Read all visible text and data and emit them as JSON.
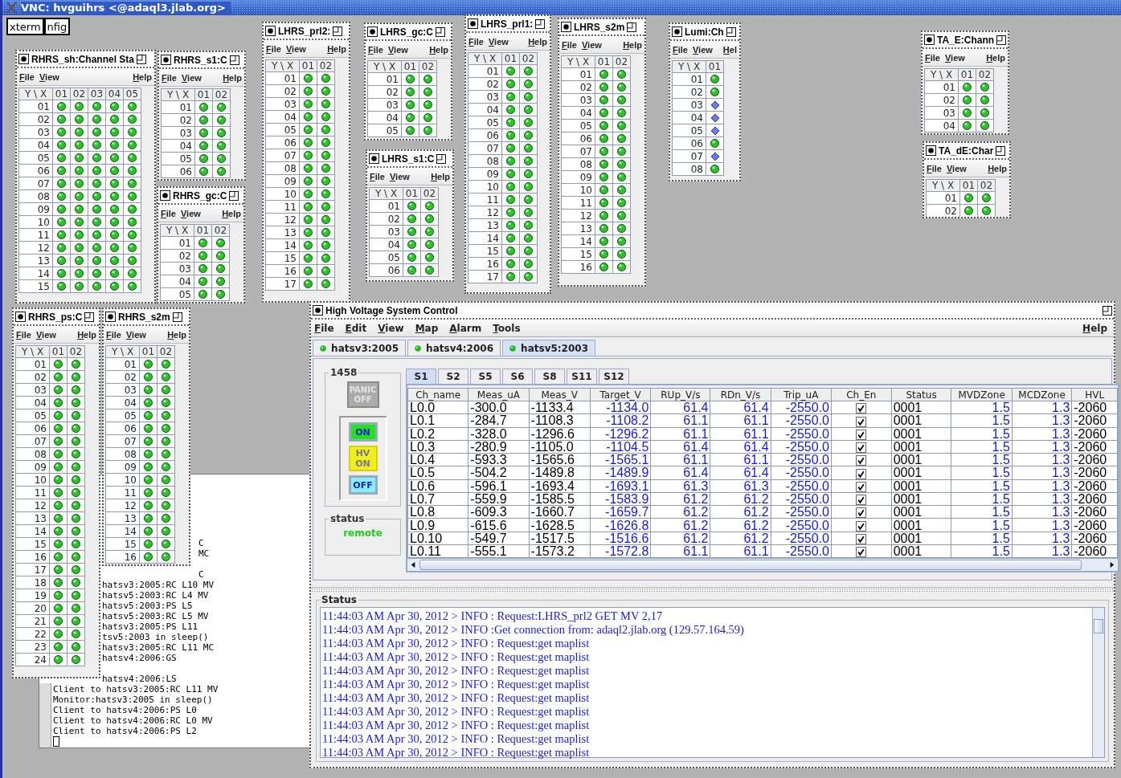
{
  "vnc": {
    "title": "VNC: hvguihrs <@adaql3.jlab.org>",
    "launchers": [
      "xterm",
      "nfig"
    ]
  },
  "windows": [
    {
      "title": "RHRS_sh:Channel Sta",
      "menu": [
        "File",
        "View",
        "Help"
      ],
      "columns": [
        "Y \\ X",
        "01",
        "02",
        "03",
        "04",
        "05"
      ],
      "rows": [
        {
          "label": "01",
          "cells": [
            {
              "kind": "led"
            },
            {
              "kind": "led"
            },
            {
              "kind": "led"
            },
            {
              "kind": "led"
            },
            {
              "kind": "led"
            }
          ]
        },
        {
          "label": "02",
          "cells": [
            {
              "kind": "led"
            },
            {
              "kind": "led"
            },
            {
              "kind": "led"
            },
            {
              "kind": "led"
            },
            {
              "kind": "led"
            }
          ]
        },
        {
          "label": "03",
          "cells": [
            {
              "kind": "led"
            },
            {
              "kind": "led"
            },
            {
              "kind": "led"
            },
            {
              "kind": "led"
            },
            {
              "kind": "led"
            }
          ]
        },
        {
          "label": "04",
          "cells": [
            {
              "kind": "led"
            },
            {
              "kind": "led"
            },
            {
              "kind": "led"
            },
            {
              "kind": "led"
            },
            {
              "kind": "led"
            }
          ]
        },
        {
          "label": "05",
          "cells": [
            {
              "kind": "led"
            },
            {
              "kind": "led"
            },
            {
              "kind": "led"
            },
            {
              "kind": "led"
            },
            {
              "kind": "led"
            }
          ]
        },
        {
          "label": "06",
          "cells": [
            {
              "kind": "led"
            },
            {
              "kind": "led"
            },
            {
              "kind": "led"
            },
            {
              "kind": "led"
            },
            {
              "kind": "led"
            }
          ]
        },
        {
          "label": "07",
          "cells": [
            {
              "kind": "led"
            },
            {
              "kind": "led"
            },
            {
              "kind": "led"
            },
            {
              "kind": "led"
            },
            {
              "kind": "led"
            }
          ]
        },
        {
          "label": "08",
          "cells": [
            {
              "kind": "led"
            },
            {
              "kind": "led"
            },
            {
              "kind": "led"
            },
            {
              "kind": "led"
            },
            {
              "kind": "led"
            }
          ]
        },
        {
          "label": "09",
          "cells": [
            {
              "kind": "led"
            },
            {
              "kind": "led"
            },
            {
              "kind": "led"
            },
            {
              "kind": "led"
            },
            {
              "kind": "led"
            }
          ]
        },
        {
          "label": "10",
          "cells": [
            {
              "kind": "led"
            },
            {
              "kind": "led"
            },
            {
              "kind": "led"
            },
            {
              "kind": "led"
            },
            {
              "kind": "led"
            }
          ]
        },
        {
          "label": "11",
          "cells": [
            {
              "kind": "led"
            },
            {
              "kind": "led"
            },
            {
              "kind": "led"
            },
            {
              "kind": "led"
            },
            {
              "kind": "led"
            }
          ]
        },
        {
          "label": "12",
          "cells": [
            {
              "kind": "led"
            },
            {
              "kind": "led"
            },
            {
              "kind": "led"
            },
            {
              "kind": "led"
            },
            {
              "kind": "led"
            }
          ]
        },
        {
          "label": "13",
          "cells": [
            {
              "kind": "led"
            },
            {
              "kind": "led"
            },
            {
              "kind": "led"
            },
            {
              "kind": "led"
            },
            {
              "kind": "led"
            }
          ]
        },
        {
          "label": "14",
          "cells": [
            {
              "kind": "led"
            },
            {
              "kind": "led"
            },
            {
              "kind": "led"
            },
            {
              "kind": "led"
            },
            {
              "kind": "led"
            }
          ]
        },
        {
          "label": "15",
          "cells": [
            {
              "kind": "led"
            },
            {
              "kind": "led"
            },
            {
              "kind": "led"
            },
            {
              "kind": "led"
            },
            {
              "kind": "led"
            }
          ]
        }
      ]
    },
    {
      "title": "RHRS_s1:C",
      "menu": [
        "File",
        "View",
        "Help"
      ],
      "columns": [
        "Y \\ X",
        "01",
        "02"
      ],
      "rows": [
        {
          "label": "01",
          "cells": [
            {
              "kind": "led"
            },
            {
              "kind": "led"
            }
          ]
        },
        {
          "label": "02",
          "cells": [
            {
              "kind": "led"
            },
            {
              "kind": "led"
            }
          ]
        },
        {
          "label": "03",
          "cells": [
            {
              "kind": "led"
            },
            {
              "kind": "led"
            }
          ]
        },
        {
          "label": "04",
          "cells": [
            {
              "kind": "led"
            },
            {
              "kind": "led"
            }
          ]
        },
        {
          "label": "05",
          "cells": [
            {
              "kind": "led"
            },
            {
              "kind": "led"
            }
          ]
        },
        {
          "label": "06",
          "cells": [
            {
              "kind": "led"
            },
            {
              "kind": "led"
            }
          ]
        }
      ]
    },
    {
      "title": "RHRS_gc:C",
      "menu": [
        "File",
        "View",
        "Help"
      ],
      "columns": [
        "Y \\ X",
        "01",
        "02"
      ],
      "rows": [
        {
          "label": "01",
          "cells": [
            {
              "kind": "led"
            },
            {
              "kind": "led"
            }
          ]
        },
        {
          "label": "02",
          "cells": [
            {
              "kind": "led"
            },
            {
              "kind": "led"
            }
          ]
        },
        {
          "label": "03",
          "cells": [
            {
              "kind": "led"
            },
            {
              "kind": "led"
            }
          ]
        },
        {
          "label": "04",
          "cells": [
            {
              "kind": "led"
            },
            {
              "kind": "led"
            }
          ]
        },
        {
          "label": "05",
          "cells": [
            {
              "kind": "led"
            },
            {
              "kind": "led"
            }
          ]
        }
      ]
    },
    {
      "title": "LHRS_prl2:",
      "menu": [
        "File",
        "View",
        "Help"
      ],
      "columns": [
        "Y \\ X",
        "01",
        "02"
      ],
      "rows": [
        {
          "label": "01",
          "cells": [
            {
              "kind": "led"
            },
            {
              "kind": "led"
            }
          ]
        },
        {
          "label": "02",
          "cells": [
            {
              "kind": "led"
            },
            {
              "kind": "led"
            }
          ]
        },
        {
          "label": "03",
          "cells": [
            {
              "kind": "led"
            },
            {
              "kind": "led"
            }
          ]
        },
        {
          "label": "04",
          "cells": [
            {
              "kind": "led"
            },
            {
              "kind": "led"
            }
          ]
        },
        {
          "label": "05",
          "cells": [
            {
              "kind": "led"
            },
            {
              "kind": "led"
            }
          ]
        },
        {
          "label": "06",
          "cells": [
            {
              "kind": "led"
            },
            {
              "kind": "led"
            }
          ]
        },
        {
          "label": "07",
          "cells": [
            {
              "kind": "led"
            },
            {
              "kind": "led"
            }
          ]
        },
        {
          "label": "08",
          "cells": [
            {
              "kind": "led"
            },
            {
              "kind": "led"
            }
          ]
        },
        {
          "label": "09",
          "cells": [
            {
              "kind": "led"
            },
            {
              "kind": "led"
            }
          ]
        },
        {
          "label": "10",
          "cells": [
            {
              "kind": "led"
            },
            {
              "kind": "led"
            }
          ]
        },
        {
          "label": "11",
          "cells": [
            {
              "kind": "led"
            },
            {
              "kind": "led"
            }
          ]
        },
        {
          "label": "12",
          "cells": [
            {
              "kind": "led"
            },
            {
              "kind": "led"
            }
          ]
        },
        {
          "label": "13",
          "cells": [
            {
              "kind": "led"
            },
            {
              "kind": "led"
            }
          ]
        },
        {
          "label": "14",
          "cells": [
            {
              "kind": "led"
            },
            {
              "kind": "led"
            }
          ]
        },
        {
          "label": "15",
          "cells": [
            {
              "kind": "led"
            },
            {
              "kind": "led"
            }
          ]
        },
        {
          "label": "16",
          "cells": [
            {
              "kind": "led"
            },
            {
              "kind": "led"
            }
          ]
        },
        {
          "label": "17",
          "cells": [
            {
              "kind": "led"
            },
            {
              "kind": "led"
            }
          ]
        }
      ]
    },
    {
      "title": "LHRS_gc:C",
      "menu": [
        "File",
        "View",
        "Help"
      ],
      "columns": [
        "Y \\ X",
        "01",
        "02"
      ],
      "rows": [
        {
          "label": "01",
          "cells": [
            {
              "kind": "led"
            },
            {
              "kind": "led"
            }
          ]
        },
        {
          "label": "02",
          "cells": [
            {
              "kind": "led"
            },
            {
              "kind": "led"
            }
          ]
        },
        {
          "label": "03",
          "cells": [
            {
              "kind": "led"
            },
            {
              "kind": "led"
            }
          ]
        },
        {
          "label": "04",
          "cells": [
            {
              "kind": "led"
            },
            {
              "kind": "led"
            }
          ]
        },
        {
          "label": "05",
          "cells": [
            {
              "kind": "led"
            },
            {
              "kind": "led"
            }
          ]
        }
      ]
    },
    {
      "title": "LHRS_s1:C",
      "menu": [
        "File",
        "View",
        "Help"
      ],
      "columns": [
        "Y \\ X",
        "01",
        "02"
      ],
      "rows": [
        {
          "label": "01",
          "cells": [
            {
              "kind": "led"
            },
            {
              "kind": "led"
            }
          ]
        },
        {
          "label": "02",
          "cells": [
            {
              "kind": "led"
            },
            {
              "kind": "led"
            }
          ]
        },
        {
          "label": "03",
          "cells": [
            {
              "kind": "led"
            },
            {
              "kind": "led"
            }
          ]
        },
        {
          "label": "04",
          "cells": [
            {
              "kind": "led"
            },
            {
              "kind": "led"
            }
          ]
        },
        {
          "label": "05",
          "cells": [
            {
              "kind": "led"
            },
            {
              "kind": "led"
            }
          ]
        },
        {
          "label": "06",
          "cells": [
            {
              "kind": "led"
            },
            {
              "kind": "led"
            }
          ]
        }
      ]
    },
    {
      "title": "LHRS_prl1:",
      "menu": [
        "File",
        "View",
        "Help"
      ],
      "columns": [
        "Y \\ X",
        "01",
        "02"
      ],
      "rows": [
        {
          "label": "01",
          "cells": [
            {
              "kind": "led"
            },
            {
              "kind": "led"
            }
          ]
        },
        {
          "label": "02",
          "cells": [
            {
              "kind": "led"
            },
            {
              "kind": "led"
            }
          ]
        },
        {
          "label": "03",
          "cells": [
            {
              "kind": "led"
            },
            {
              "kind": "led"
            }
          ]
        },
        {
          "label": "04",
          "cells": [
            {
              "kind": "led"
            },
            {
              "kind": "led"
            }
          ]
        },
        {
          "label": "05",
          "cells": [
            {
              "kind": "led"
            },
            {
              "kind": "led"
            }
          ]
        },
        {
          "label": "06",
          "cells": [
            {
              "kind": "led"
            },
            {
              "kind": "led"
            }
          ]
        },
        {
          "label": "07",
          "cells": [
            {
              "kind": "led"
            },
            {
              "kind": "led"
            }
          ]
        },
        {
          "label": "08",
          "cells": [
            {
              "kind": "led"
            },
            {
              "kind": "led"
            }
          ]
        },
        {
          "label": "09",
          "cells": [
            {
              "kind": "led"
            },
            {
              "kind": "led"
            }
          ]
        },
        {
          "label": "10",
          "cells": [
            {
              "kind": "led"
            },
            {
              "kind": "led"
            }
          ]
        },
        {
          "label": "11",
          "cells": [
            {
              "kind": "led"
            },
            {
              "kind": "led"
            }
          ]
        },
        {
          "label": "12",
          "cells": [
            {
              "kind": "led"
            },
            {
              "kind": "led"
            }
          ]
        },
        {
          "label": "13",
          "cells": [
            {
              "kind": "led"
            },
            {
              "kind": "led"
            }
          ]
        },
        {
          "label": "14",
          "cells": [
            {
              "kind": "led"
            },
            {
              "kind": "led"
            }
          ]
        },
        {
          "label": "15",
          "cells": [
            {
              "kind": "led"
            },
            {
              "kind": "led"
            }
          ]
        },
        {
          "label": "16",
          "cells": [
            {
              "kind": "led"
            },
            {
              "kind": "led"
            }
          ]
        },
        {
          "label": "17",
          "cells": [
            {
              "kind": "led"
            },
            {
              "kind": "led"
            }
          ]
        }
      ]
    },
    {
      "title": "LHRS_s2m",
      "menu": [
        "File",
        "View",
        "Help"
      ],
      "columns": [
        "Y \\ X",
        "01",
        "02"
      ],
      "rows": [
        {
          "label": "01",
          "cells": [
            {
              "kind": "led"
            },
            {
              "kind": "led"
            }
          ]
        },
        {
          "label": "02",
          "cells": [
            {
              "kind": "led"
            },
            {
              "kind": "led"
            }
          ]
        },
        {
          "label": "03",
          "cells": [
            {
              "kind": "led"
            },
            {
              "kind": "led"
            }
          ]
        },
        {
          "label": "04",
          "cells": [
            {
              "kind": "led"
            },
            {
              "kind": "led"
            }
          ]
        },
        {
          "label": "05",
          "cells": [
            {
              "kind": "led"
            },
            {
              "kind": "led"
            }
          ]
        },
        {
          "label": "06",
          "cells": [
            {
              "kind": "led"
            },
            {
              "kind": "led"
            }
          ]
        },
        {
          "label": "07",
          "cells": [
            {
              "kind": "led"
            },
            {
              "kind": "led"
            }
          ]
        },
        {
          "label": "08",
          "cells": [
            {
              "kind": "led"
            },
            {
              "kind": "led"
            }
          ]
        },
        {
          "label": "09",
          "cells": [
            {
              "kind": "led"
            },
            {
              "kind": "led"
            }
          ]
        },
        {
          "label": "10",
          "cells": [
            {
              "kind": "led"
            },
            {
              "kind": "led"
            }
          ]
        },
        {
          "label": "11",
          "cells": [
            {
              "kind": "led"
            },
            {
              "kind": "led"
            }
          ]
        },
        {
          "label": "12",
          "cells": [
            {
              "kind": "led"
            },
            {
              "kind": "led"
            }
          ]
        },
        {
          "label": "13",
          "cells": [
            {
              "kind": "led"
            },
            {
              "kind": "led"
            }
          ]
        },
        {
          "label": "14",
          "cells": [
            {
              "kind": "led"
            },
            {
              "kind": "led"
            }
          ]
        },
        {
          "label": "15",
          "cells": [
            {
              "kind": "led"
            },
            {
              "kind": "led"
            }
          ]
        },
        {
          "label": "16",
          "cells": [
            {
              "kind": "led"
            },
            {
              "kind": "led"
            }
          ]
        }
      ]
    },
    {
      "title": "Lumi:Ch",
      "menu": [
        "File",
        "View",
        "Hel"
      ],
      "columns": [
        "Y \\ X",
        "01"
      ],
      "rows": [
        {
          "label": "01",
          "cells": [
            {
              "kind": "led"
            }
          ]
        },
        {
          "label": "02",
          "cells": [
            {
              "kind": "led"
            }
          ]
        },
        {
          "label": "03",
          "cells": [
            {
              "kind": "diamond"
            }
          ]
        },
        {
          "label": "04",
          "cells": [
            {
              "kind": "diamond"
            }
          ]
        },
        {
          "label": "05",
          "cells": [
            {
              "kind": "diamond"
            }
          ]
        },
        {
          "label": "06",
          "cells": [
            {
              "kind": "led"
            }
          ]
        },
        {
          "label": "07",
          "cells": [
            {
              "kind": "diamond"
            }
          ]
        },
        {
          "label": "08",
          "cells": [
            {
              "kind": "led"
            }
          ]
        }
      ]
    },
    {
      "title": "TA_E:Chann",
      "menu": [
        "File",
        "View",
        "Help"
      ],
      "columns": [
        "Y \\ X",
        "01",
        "02"
      ],
      "rows": [
        {
          "label": "01",
          "cells": [
            {
              "kind": "led"
            },
            {
              "kind": "led"
            }
          ]
        },
        {
          "label": "02",
          "cells": [
            {
              "kind": "led"
            },
            {
              "kind": "led"
            }
          ]
        },
        {
          "label": "03",
          "cells": [
            {
              "kind": "led"
            },
            {
              "kind": "led"
            }
          ]
        },
        {
          "label": "04",
          "cells": [
            {
              "kind": "led"
            },
            {
              "kind": "led"
            }
          ]
        }
      ]
    },
    {
      "title": "TA_dE:Char",
      "menu": [
        "File",
        "View",
        "Help"
      ],
      "columns": [
        "Y \\ X",
        "01",
        "02"
      ],
      "rows": [
        {
          "label": "01",
          "cells": [
            {
              "kind": "led"
            },
            {
              "kind": "led"
            }
          ]
        },
        {
          "label": "02",
          "cells": [
            {
              "kind": "led"
            },
            {
              "kind": "led"
            }
          ]
        }
      ]
    },
    {
      "title": "RHRS_ps:C",
      "menu": [
        "File",
        "View",
        "Help"
      ],
      "columns": [
        "Y \\ X",
        "01",
        "02"
      ],
      "rows": [
        {
          "label": "01",
          "cells": [
            {
              "kind": "led"
            },
            {
              "kind": "led"
            }
          ]
        },
        {
          "label": "02",
          "cells": [
            {
              "kind": "led"
            },
            {
              "kind": "led"
            }
          ]
        },
        {
          "label": "03",
          "cells": [
            {
              "kind": "led"
            },
            {
              "kind": "led"
            }
          ]
        },
        {
          "label": "04",
          "cells": [
            {
              "kind": "led"
            },
            {
              "kind": "led"
            }
          ]
        },
        {
          "label": "05",
          "cells": [
            {
              "kind": "led"
            },
            {
              "kind": "led"
            }
          ]
        },
        {
          "label": "06",
          "cells": [
            {
              "kind": "led"
            },
            {
              "kind": "led"
            }
          ]
        },
        {
          "label": "07",
          "cells": [
            {
              "kind": "led"
            },
            {
              "kind": "led"
            }
          ]
        },
        {
          "label": "08",
          "cells": [
            {
              "kind": "led"
            },
            {
              "kind": "led"
            }
          ]
        },
        {
          "label": "09",
          "cells": [
            {
              "kind": "led"
            },
            {
              "kind": "led"
            }
          ]
        },
        {
          "label": "10",
          "cells": [
            {
              "kind": "led"
            },
            {
              "kind": "led"
            }
          ]
        },
        {
          "label": "11",
          "cells": [
            {
              "kind": "led"
            },
            {
              "kind": "led"
            }
          ]
        },
        {
          "label": "12",
          "cells": [
            {
              "kind": "led"
            },
            {
              "kind": "led"
            }
          ]
        },
        {
          "label": "13",
          "cells": [
            {
              "kind": "led"
            },
            {
              "kind": "led"
            }
          ]
        },
        {
          "label": "14",
          "cells": [
            {
              "kind": "led"
            },
            {
              "kind": "led"
            }
          ]
        },
        {
          "label": "15",
          "cells": [
            {
              "kind": "led"
            },
            {
              "kind": "led"
            }
          ]
        },
        {
          "label": "16",
          "cells": [
            {
              "kind": "led"
            },
            {
              "kind": "led"
            }
          ]
        },
        {
          "label": "17",
          "cells": [
            {
              "kind": "led"
            },
            {
              "kind": "led"
            }
          ]
        },
        {
          "label": "18",
          "cells": [
            {
              "kind": "led"
            },
            {
              "kind": "led"
            }
          ]
        },
        {
          "label": "19",
          "cells": [
            {
              "kind": "led"
            },
            {
              "kind": "led"
            }
          ]
        },
        {
          "label": "20",
          "cells": [
            {
              "kind": "led"
            },
            {
              "kind": "led"
            }
          ]
        },
        {
          "label": "21",
          "cells": [
            {
              "kind": "led"
            },
            {
              "kind": "led"
            }
          ]
        },
        {
          "label": "22",
          "cells": [
            {
              "kind": "led"
            },
            {
              "kind": "led"
            }
          ]
        },
        {
          "label": "23",
          "cells": [
            {
              "kind": "led"
            },
            {
              "kind": "led"
            }
          ]
        },
        {
          "label": "24",
          "cells": [
            {
              "kind": "led"
            },
            {
              "kind": "led"
            }
          ]
        }
      ]
    },
    {
      "title": "RHRS_s2m",
      "menu": [
        "File",
        "View",
        "Help"
      ],
      "columns": [
        "Y \\ X",
        "01",
        "02"
      ],
      "rows": [
        {
          "label": "01",
          "cells": [
            {
              "kind": "led"
            },
            {
              "kind": "led"
            }
          ]
        },
        {
          "label": "02",
          "cells": [
            {
              "kind": "led"
            },
            {
              "kind": "led"
            }
          ]
        },
        {
          "label": "03",
          "cells": [
            {
              "kind": "led"
            },
            {
              "kind": "led"
            }
          ]
        },
        {
          "label": "04",
          "cells": [
            {
              "kind": "led"
            },
            {
              "kind": "led"
            }
          ]
        },
        {
          "label": "05",
          "cells": [
            {
              "kind": "led"
            },
            {
              "kind": "led"
            }
          ]
        },
        {
          "label": "06",
          "cells": [
            {
              "kind": "led"
            },
            {
              "kind": "led"
            }
          ]
        },
        {
          "label": "07",
          "cells": [
            {
              "kind": "led"
            },
            {
              "kind": "led"
            }
          ]
        },
        {
          "label": "08",
          "cells": [
            {
              "kind": "led"
            },
            {
              "kind": "led"
            }
          ]
        },
        {
          "label": "09",
          "cells": [
            {
              "kind": "led"
            },
            {
              "kind": "led"
            }
          ]
        },
        {
          "label": "10",
          "cells": [
            {
              "kind": "led"
            },
            {
              "kind": "led"
            }
          ]
        },
        {
          "label": "11",
          "cells": [
            {
              "kind": "led"
            },
            {
              "kind": "led"
            }
          ]
        },
        {
          "label": "12",
          "cells": [
            {
              "kind": "led"
            },
            {
              "kind": "led"
            }
          ]
        },
        {
          "label": "13",
          "cells": [
            {
              "kind": "led"
            },
            {
              "kind": "led"
            }
          ]
        },
        {
          "label": "14",
          "cells": [
            {
              "kind": "led"
            },
            {
              "kind": "led"
            }
          ]
        },
        {
          "label": "15",
          "cells": [
            {
              "kind": "led"
            },
            {
              "kind": "led"
            }
          ]
        },
        {
          "label": "16",
          "cells": [
            {
              "kind": "led"
            },
            {
              "kind": "led"
            }
          ]
        }
      ]
    }
  ],
  "xterm": {
    "lines": [
      "C",
      "MC",
      "C",
      "hatsv3:2005:RC L10 MV",
      "hatsv5:2003:RC L4 MV",
      "hatsv5:2003:PS L5",
      "hatsv5:2003:RC L5 MV",
      "hatsv3:2005:PS L11",
      "tsv5:2003 in sleep()",
      "hatsv3:2005:RC L11 MC",
      "hatsv4:2006:GS",
      "hatsv4:2006:LS",
      "Client to hatsv3:2005:RC L11 MV",
      "Monitor:hatsv3:2005 in sleep()",
      "Client to hatsv4:2006:PS L0",
      "Client to hatsv4:2006:RC L0 MV",
      "Client to hatsv4:2006:PS L2"
    ]
  },
  "hv": {
    "title": "High Voltage System Control",
    "menu": [
      "File",
      "Edit",
      "View",
      "Map",
      "Alarm",
      "Tools"
    ],
    "help": "Help",
    "servers": [
      {
        "label": "hatsv3:2005",
        "selected": false
      },
      {
        "label": "hatsv4:2006",
        "selected": false
      },
      {
        "label": "hatsv5:2003",
        "selected": true
      }
    ],
    "crate": "1458",
    "panic": {
      "label": "PANIC OFF",
      "disabled": true
    },
    "controls": [
      {
        "label": "ON",
        "kind": "on"
      },
      {
        "label": "HV ON",
        "kind": "indicator"
      },
      {
        "label": "OFF",
        "kind": "off"
      }
    ],
    "status": {
      "label": "status",
      "value": "remote"
    },
    "slots": [
      {
        "label": "S1",
        "selected": true
      },
      {
        "label": "S2",
        "selected": false
      },
      {
        "label": "S5",
        "selected": false
      },
      {
        "label": "S6",
        "selected": false
      },
      {
        "label": "S8",
        "selected": false
      },
      {
        "label": "S11",
        "selected": false
      },
      {
        "label": "S12",
        "selected": false
      }
    ],
    "columns": [
      {
        "label": "Ch_name",
        "kind": "text"
      },
      {
        "label": "Meas_uA",
        "kind": "text"
      },
      {
        "label": "Meas_V",
        "kind": "text"
      },
      {
        "label": "Target_V",
        "kind": "value"
      },
      {
        "label": "RUp_V/s",
        "kind": "value"
      },
      {
        "label": "RDn_V/s",
        "kind": "value"
      },
      {
        "label": "Trip_uA",
        "kind": "value"
      },
      {
        "label": "Ch_En",
        "kind": "check"
      },
      {
        "label": "Status",
        "kind": "text"
      },
      {
        "label": "MVDZone",
        "kind": "value"
      },
      {
        "label": "MCDZone",
        "kind": "value"
      },
      {
        "label": "HVL",
        "kind": "text"
      }
    ],
    "rows": [
      {
        "cells": [
          "L0.0",
          "-300.0",
          "-1133.4",
          "-1134.0",
          "61.4",
          "61.4",
          "-2550.0",
          "",
          "0001",
          "1.5",
          "1.3",
          "-2060"
        ],
        "enabled": true
      },
      {
        "cells": [
          "L0.1",
          "-284.7",
          "-1108.3",
          "-1108.2",
          "61.1",
          "61.1",
          "-2550.0",
          "",
          "0001",
          "1.5",
          "1.3",
          "-2060"
        ],
        "enabled": true
      },
      {
        "cells": [
          "L0.2",
          "-328.0",
          "-1296.6",
          "-1296.2",
          "61.1",
          "61.1",
          "-2550.0",
          "",
          "0001",
          "1.5",
          "1.3",
          "-2060"
        ],
        "enabled": true
      },
      {
        "cells": [
          "L0.3",
          "-280.9",
          "-1105.0",
          "-1104.5",
          "61.4",
          "61.4",
          "-2550.0",
          "",
          "0001",
          "1.5",
          "1.3",
          "-2060"
        ],
        "enabled": true
      },
      {
        "cells": [
          "L0.4",
          "-593.3",
          "-1565.6",
          "-1565.1",
          "61.1",
          "61.1",
          "-2550.0",
          "",
          "0001",
          "1.5",
          "1.3",
          "-2060"
        ],
        "enabled": true
      },
      {
        "cells": [
          "L0.5",
          "-504.2",
          "-1489.8",
          "-1489.9",
          "61.4",
          "61.4",
          "-2550.0",
          "",
          "0001",
          "1.5",
          "1.3",
          "-2060"
        ],
        "enabled": true
      },
      {
        "cells": [
          "L0.6",
          "-596.1",
          "-1693.4",
          "-1693.1",
          "61.3",
          "61.3",
          "-2550.0",
          "",
          "0001",
          "1.5",
          "1.3",
          "-2060"
        ],
        "enabled": true
      },
      {
        "cells": [
          "L0.7",
          "-559.9",
          "-1585.5",
          "-1583.9",
          "61.2",
          "61.2",
          "-2550.0",
          "",
          "0001",
          "1.5",
          "1.3",
          "-2060"
        ],
        "enabled": true
      },
      {
        "cells": [
          "L0.8",
          "-609.3",
          "-1660.7",
          "-1659.7",
          "61.2",
          "61.2",
          "-2550.0",
          "",
          "0001",
          "1.5",
          "1.3",
          "-2060"
        ],
        "enabled": true
      },
      {
        "cells": [
          "L0.9",
          "-615.6",
          "-1628.5",
          "-1626.8",
          "61.2",
          "61.2",
          "-2550.0",
          "",
          "0001",
          "1.5",
          "1.3",
          "-2060"
        ],
        "enabled": true
      },
      {
        "cells": [
          "L0.10",
          "-549.7",
          "-1517.5",
          "-1516.6",
          "61.2",
          "61.2",
          "-2550.0",
          "",
          "0001",
          "1.5",
          "1.3",
          "-2060"
        ],
        "enabled": true
      },
      {
        "cells": [
          "L0.11",
          "-555.1",
          "-1573.2",
          "-1572.8",
          "61.1",
          "61.1",
          "-2550.0",
          "",
          "0001",
          "1.5",
          "1.3",
          "-2060"
        ],
        "enabled": true
      }
    ],
    "log": {
      "label": "Status",
      "lines": [
        "11:44:03 AM Apr 30, 2012 > INFO : Request:LHRS_prl2 GET MV 2,17",
        "11:44:03 AM Apr 30, 2012 > INFO :Get connection from: adaql2.jlab.org (129.57.164.59)",
        "11:44:03 AM Apr 30, 2012 > INFO : Request:get maplist",
        "11:44:03 AM Apr 30, 2012 > INFO : Request:get maplist",
        "11:44:03 AM Apr 30, 2012 > INFO : Request:get maplist",
        "11:44:03 AM Apr 30, 2012 > INFO : Request:get maplist",
        "11:44:03 AM Apr 30, 2012 > INFO : Request:get maplist",
        "11:44:03 AM Apr 30, 2012 > INFO : Request:get maplist",
        "11:44:03 AM Apr 30, 2012 > INFO : Request:get maplist",
        "11:44:03 AM Apr 30, 2012 > INFO : Request:get maplist",
        "11:44:03 AM Apr 30, 2012 > INFO : Request:get maplist"
      ]
    }
  }
}
